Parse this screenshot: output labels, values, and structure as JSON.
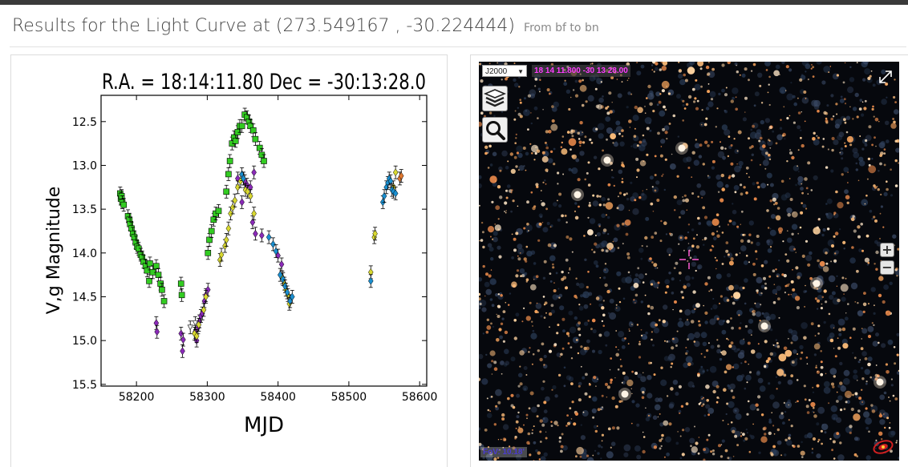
{
  "page": {
    "title": "Results for the Light Curve at (273.549167 , -30.224444)",
    "subtitle": "From bf to bn"
  },
  "chart_data": {
    "type": "scatter",
    "title": "R.A. = 18:14:11.80   Dec = -30:13:28.0",
    "xlabel": "MJD",
    "ylabel": "V,g Magnitude",
    "xlim": [
      58150,
      58610
    ],
    "ylim": [
      15.52,
      12.2
    ],
    "y_inverted": true,
    "xticks": [
      "58200",
      "58300",
      "58400",
      "58500",
      "58600"
    ],
    "xtick_values": [
      58200,
      58300,
      58400,
      58500,
      58600
    ],
    "yticks": [
      "12.5",
      "13.0",
      "13.5",
      "14.0",
      "14.5",
      "15.0",
      "15.5"
    ],
    "ytick_values": [
      12.5,
      13.0,
      13.5,
      14.0,
      14.5,
      15.0,
      15.5
    ],
    "grid": false,
    "series": [
      {
        "marker": "square",
        "color": "#33cc22",
        "points": [
          [
            58177,
            13.32
          ],
          [
            58178,
            13.38
          ],
          [
            58179,
            13.35
          ],
          [
            58180,
            13.42
          ],
          [
            58182,
            13.45
          ],
          [
            58188,
            13.58
          ],
          [
            58190,
            13.62
          ],
          [
            58191,
            13.67
          ],
          [
            58193,
            13.72
          ],
          [
            58195,
            13.78
          ],
          [
            58197,
            13.82
          ],
          [
            58199,
            13.88
          ],
          [
            58201,
            13.93
          ],
          [
            58203,
            13.95
          ],
          [
            58206,
            14.02
          ],
          [
            58208,
            14.05
          ],
          [
            58210,
            14.1
          ],
          [
            58213,
            14.15
          ],
          [
            58215,
            14.2
          ],
          [
            58218,
            14.32
          ],
          [
            58219,
            14.12
          ],
          [
            58223,
            14.22
          ],
          [
            58228,
            14.15
          ],
          [
            58231,
            14.25
          ],
          [
            58234,
            14.35
          ],
          [
            58236,
            14.42
          ],
          [
            58239,
            14.55
          ],
          [
            58263,
            14.35
          ],
          [
            58264,
            14.48
          ],
          [
            58301,
            14.0
          ],
          [
            58303,
            13.85
          ],
          [
            58306,
            13.75
          ],
          [
            58309,
            13.62
          ],
          [
            58312,
            13.55
          ],
          [
            58316,
            13.52
          ],
          [
            58327,
            13.3
          ],
          [
            58330,
            13.1
          ],
          [
            58332,
            12.95
          ],
          [
            58335,
            12.75
          ],
          [
            58338,
            12.68
          ],
          [
            58340,
            12.72
          ],
          [
            58343,
            12.62
          ],
          [
            58346,
            12.55
          ],
          [
            58349,
            12.55
          ],
          [
            58353,
            12.42
          ],
          [
            58356,
            12.45
          ],
          [
            58359,
            12.5
          ],
          [
            58361,
            12.55
          ],
          [
            58365,
            12.6
          ],
          [
            58368,
            12.7
          ],
          [
            58374,
            12.8
          ],
          [
            58377,
            12.88
          ],
          [
            58380,
            12.95
          ]
        ]
      },
      {
        "marker": "diamond",
        "color": "#8a2ab8",
        "points": [
          [
            58228,
            14.8
          ],
          [
            58229,
            14.9
          ],
          [
            58263,
            14.92
          ],
          [
            58265,
            15.12
          ],
          [
            58266,
            14.99
          ],
          [
            58283,
            14.9
          ],
          [
            58285,
            15.0
          ],
          [
            58287,
            14.85
          ],
          [
            58289,
            14.78
          ],
          [
            58291,
            14.72
          ],
          [
            58293,
            14.69
          ],
          [
            58296,
            14.55
          ],
          [
            58298,
            14.48
          ],
          [
            58301,
            14.42
          ],
          [
            58343,
            13.15
          ],
          [
            58349,
            13.42
          ],
          [
            58353,
            13.18
          ],
          [
            58356,
            13.22
          ],
          [
            58361,
            13.25
          ],
          [
            58364,
            13.65
          ],
          [
            58366,
            13.08
          ],
          [
            58368,
            13.78
          ],
          [
            58377,
            13.8
          ],
          [
            58400,
            14.03
          ],
          [
            58405,
            14.13
          ]
        ]
      },
      {
        "marker": "diamond",
        "color": "#d8d830",
        "points": [
          [
            58282,
            14.92
          ],
          [
            58285,
            14.95
          ],
          [
            58288,
            14.82
          ],
          [
            58295,
            14.65
          ],
          [
            58298,
            14.5
          ],
          [
            58318,
            14.08
          ],
          [
            58320,
            14.02
          ],
          [
            58325,
            13.92
          ],
          [
            58327,
            13.85
          ],
          [
            58330,
            13.72
          ],
          [
            58333,
            13.55
          ],
          [
            58336,
            13.48
          ],
          [
            58339,
            13.4
          ],
          [
            58343,
            13.25
          ],
          [
            58347,
            13.18
          ],
          [
            58351,
            13.15
          ],
          [
            58354,
            13.28
          ],
          [
            58357,
            13.3
          ],
          [
            58361,
            13.35
          ],
          [
            58366,
            13.55
          ],
          [
            58406,
            14.28
          ],
          [
            58409,
            14.35
          ],
          [
            58411,
            14.42
          ],
          [
            58414,
            14.48
          ],
          [
            58416,
            14.58
          ],
          [
            58531,
            14.22
          ],
          [
            58536,
            13.82
          ],
          [
            58537,
            13.78
          ],
          [
            58563,
            13.25
          ],
          [
            58566,
            13.08
          ]
        ]
      },
      {
        "marker": "diamond",
        "color": "#1a8fd0",
        "points": [
          [
            58349,
            13.1
          ],
          [
            58351,
            13.15
          ],
          [
            58387,
            13.82
          ],
          [
            58393,
            13.9
          ],
          [
            58397,
            13.98
          ],
          [
            58403,
            14.25
          ],
          [
            58407,
            14.3
          ],
          [
            58410,
            14.38
          ],
          [
            58413,
            14.45
          ],
          [
            58417,
            14.55
          ],
          [
            58420,
            14.5
          ],
          [
            58531,
            14.32
          ],
          [
            58548,
            13.42
          ],
          [
            58550,
            13.35
          ],
          [
            58553,
            13.25
          ],
          [
            58555,
            13.2
          ],
          [
            58557,
            13.15
          ],
          [
            58559,
            13.18
          ],
          [
            58561,
            13.28
          ],
          [
            58563,
            13.3
          ],
          [
            58566,
            13.32
          ]
        ]
      },
      {
        "marker": "diamond",
        "color": "#e07830",
        "points": [
          [
            58572,
            13.15
          ],
          [
            58574,
            13.12
          ]
        ]
      },
      {
        "marker": "triangle-down",
        "color": "#333333",
        "points": [
          [
            58276,
            14.85
          ],
          [
            58283,
            14.8
          ]
        ]
      }
    ]
  },
  "sky": {
    "frame_option": "J2000",
    "coordinates": "18 14 11.800 -30 13 28.00",
    "fov": "FoV: 10.18'",
    "zoom_in": "+",
    "zoom_out": "−",
    "icons": [
      "layers-icon",
      "search-icon",
      "expand-icon",
      "aladin-logo-icon"
    ]
  }
}
